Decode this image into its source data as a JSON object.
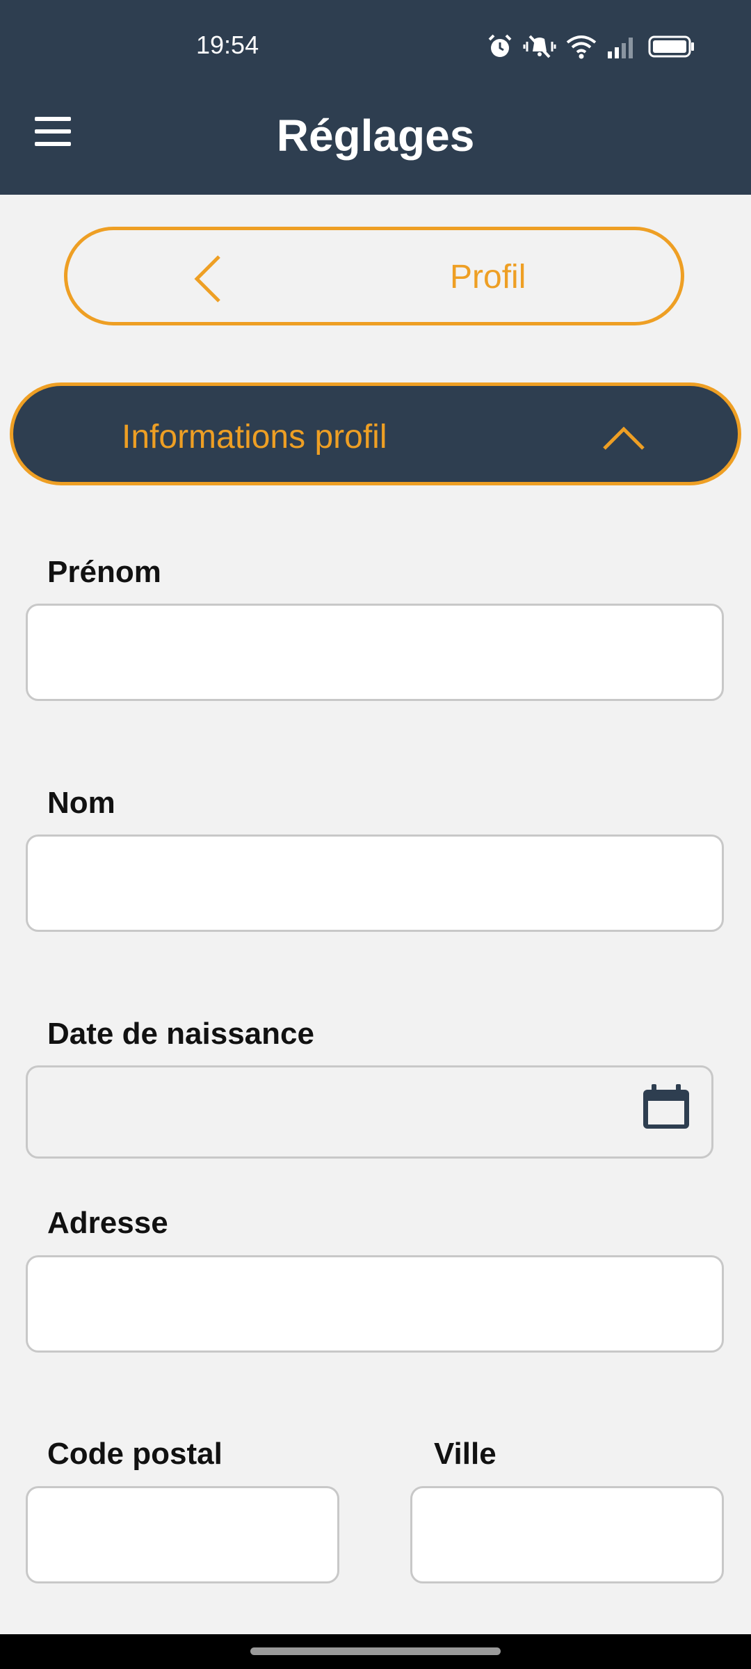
{
  "status_bar": {
    "time": "19:54",
    "icons": [
      "alarm-icon",
      "vibrate-mute-icon",
      "wifi-icon",
      "signal-icon",
      "battery-icon"
    ]
  },
  "app_bar": {
    "menu_icon": "hamburger-menu-icon",
    "title": "Réglages"
  },
  "profile_nav": {
    "back_icon": "chevron-left-icon",
    "label": "Profil"
  },
  "section": {
    "title": "Informations profil",
    "toggle_icon": "chevron-up-icon",
    "expanded": true
  },
  "form": {
    "first_name": {
      "label": "Prénom",
      "value": ""
    },
    "last_name": {
      "label": "Nom",
      "value": ""
    },
    "birth_date": {
      "label": "Date de naissance",
      "value": "",
      "icon": "calendar-icon"
    },
    "address": {
      "label": "Adresse",
      "value": ""
    },
    "postal_code": {
      "label": "Code postal",
      "value": ""
    },
    "city": {
      "label": "Ville",
      "value": ""
    }
  },
  "colors": {
    "primary_dark": "#2e3e50",
    "accent": "#ee9f24",
    "background": "#f2f2f2"
  }
}
